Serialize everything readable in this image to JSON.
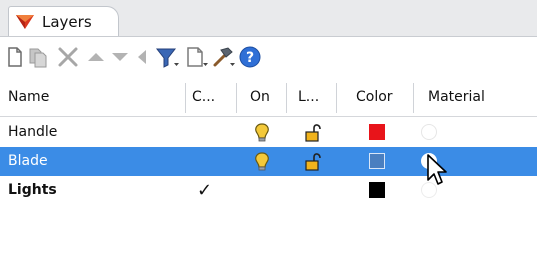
{
  "panel": {
    "tab_label": "Layers",
    "tab_icon": "layers-icon"
  },
  "toolbar": {
    "buttons": [
      {
        "name": "new-layer-icon"
      },
      {
        "name": "new-sublayer-icon"
      },
      {
        "name": "delete-icon"
      },
      {
        "name": "move-up-icon"
      },
      {
        "name": "move-down-icon"
      },
      {
        "name": "move-to-parent-icon"
      },
      {
        "name": "filter-icon"
      },
      {
        "name": "tools-icon"
      },
      {
        "name": "help-icon"
      }
    ]
  },
  "columns": {
    "name": "Name",
    "current": "C...",
    "on": "On",
    "lock": "L...",
    "color": "Color",
    "material": "Material"
  },
  "layers": [
    {
      "name": "Handle",
      "current": "",
      "on": true,
      "locked": false,
      "color": "#e8141a",
      "selected": false,
      "bold": false
    },
    {
      "name": "Blade",
      "current": "",
      "on": true,
      "locked": false,
      "color": "#4a7fc0",
      "selected": true,
      "bold": false
    },
    {
      "name": "Lights",
      "current": "✓",
      "on": false,
      "locked": false,
      "color": "#000000",
      "selected": false,
      "bold": true
    }
  ],
  "colors": {
    "selection": "#3b8ce6",
    "bulb": "#f4c93a",
    "lock": "#f1b31c"
  }
}
